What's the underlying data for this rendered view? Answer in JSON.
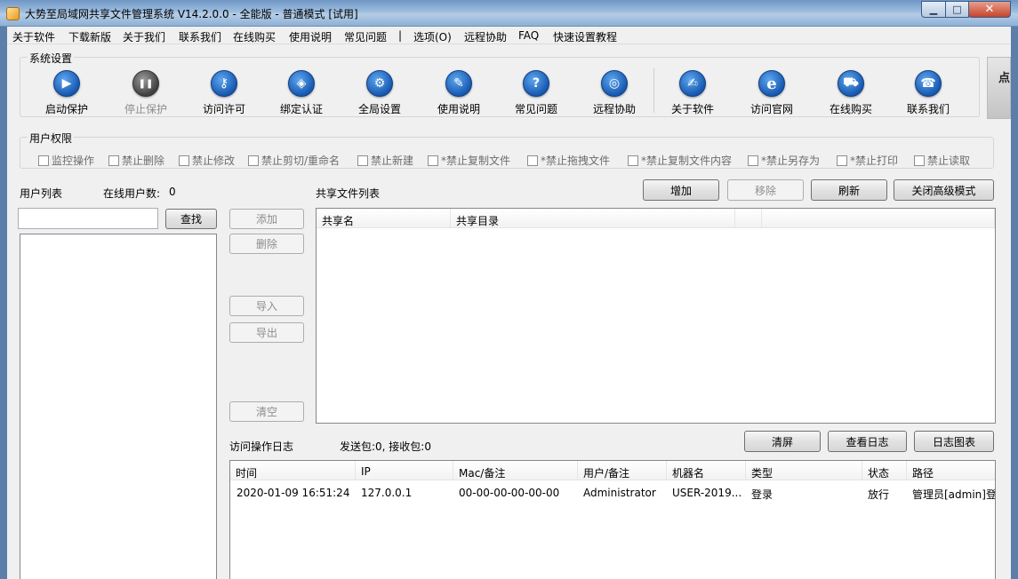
{
  "window": {
    "title": "大势至局域网共享文件管理系统 V14.2.0.0 - 全能版 - 普通模式 [试用]",
    "min_glyph": "▁",
    "max_glyph": "□",
    "close_glyph": "✕"
  },
  "menu": [
    "关于软件",
    "下载新版",
    "关于我们",
    "联系我们",
    "在线购买",
    "使用说明",
    "常见问题",
    "|",
    "选项(O)",
    "远程协助",
    "FAQ",
    "快速设置教程"
  ],
  "system_settings": {
    "title": "系统设置",
    "buttons": [
      {
        "label": "启动保护",
        "icon": "play-icon",
        "glyph": "▶",
        "enabled": true
      },
      {
        "label": "停止保护",
        "icon": "pause-icon",
        "glyph": "❚❚",
        "enabled": false
      },
      {
        "label": "访问许可",
        "icon": "key-icon",
        "glyph": "⚷",
        "enabled": true
      },
      {
        "label": "绑定认证",
        "icon": "shield-icon",
        "glyph": "◈",
        "enabled": true
      },
      {
        "label": "全局设置",
        "icon": "gear-icon",
        "glyph": "⚙",
        "enabled": true
      },
      {
        "label": "使用说明",
        "icon": "graduation-cap-icon",
        "glyph": "✎",
        "enabled": true
      },
      {
        "label": "常见问题",
        "icon": "question-icon",
        "glyph": "?",
        "enabled": true
      },
      {
        "label": "远程协助",
        "icon": "globe-icon",
        "glyph": "◎",
        "enabled": true
      },
      {
        "label": "关于软件",
        "icon": "edit-icon",
        "glyph": "✍",
        "enabled": true
      },
      {
        "label": "访问官网",
        "icon": "ie-icon",
        "glyph": "e",
        "enabled": true
      },
      {
        "label": "在线购买",
        "icon": "cart-icon",
        "glyph": "⛟",
        "enabled": true
      },
      {
        "label": "联系我们",
        "icon": "phone-icon",
        "glyph": "☎",
        "enabled": true
      }
    ]
  },
  "side_image_text": "点",
  "permissions": {
    "title": "用户权限",
    "items": [
      "监控操作",
      "禁止删除",
      "禁止修改",
      "禁止剪切/重命名",
      "禁止新建",
      "*禁止复制文件",
      "*禁止拖拽文件",
      "*禁止复制文件内容",
      "*禁止另存为",
      "*禁止打印",
      "禁止读取"
    ]
  },
  "users": {
    "title": "用户列表",
    "online_label": "在线用户数:",
    "online_count": "0",
    "search_value": "",
    "search_button": "查找"
  },
  "middle_buttons": {
    "add": "添加",
    "delete": "删除",
    "import": "导入",
    "export": "导出",
    "clear": "清空"
  },
  "shares": {
    "title": "共享文件列表",
    "buttons": {
      "add": "增加",
      "remove": "移除",
      "refresh": "刷新",
      "close_advanced": "关闭高级模式"
    },
    "columns": [
      "共享名",
      "共享目录",
      "",
      ""
    ]
  },
  "log": {
    "title": "访问操作日志",
    "packets": "发送包:0, 接收包:0",
    "buttons": {
      "clear": "清屏",
      "view": "查看日志",
      "chart": "日志图表"
    },
    "columns": [
      "时间",
      "IP",
      "Mac/备注",
      "用户/备注",
      "机器名",
      "类型",
      "状态",
      "路径"
    ],
    "rows": [
      [
        "2020-01-09 16:51:24",
        "127.0.0.1",
        "00-00-00-00-00-00",
        "Administrator",
        "USER-2019...",
        "登录",
        "放行",
        "管理员[admin]登录"
      ]
    ]
  }
}
